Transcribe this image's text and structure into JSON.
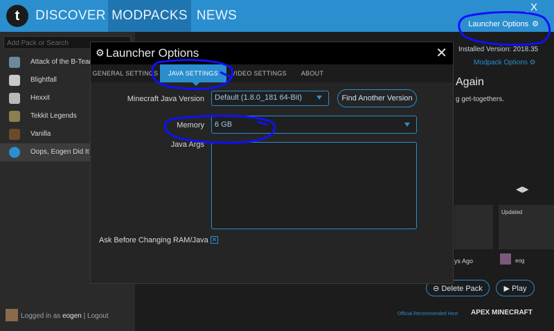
{
  "nav": {
    "tabs": [
      "DISCOVER",
      "MODPACKS",
      "NEWS"
    ],
    "active": "MODPACKS"
  },
  "window": {
    "minimize": "_",
    "close": "X"
  },
  "launcher_options_button": "Launcher Options",
  "sidebar": {
    "search_placeholder": "Add Pack or Search",
    "packs": [
      "Attack of the B-Team",
      "Blightfall",
      "Hexxit",
      "Tekkit Legends",
      "Vanilla",
      "Oops, Eogen Did It Ag"
    ]
  },
  "right": {
    "installed": "Installed Version: 2018.35",
    "modpack_options": "Modpack Options",
    "title_fragment": "Again",
    "desc_fragment": "g get-togethers.",
    "updated_fragment": "Updated",
    "ago_fragment": "ys Ago",
    "eog_fragment": "eog",
    "delete_btn": "Delete Pack",
    "play_btn": "Play"
  },
  "footer": {
    "logged_prefix": "Logged in as",
    "user": "eogen",
    "logout": "| Logout",
    "host_text": "Official Recommended Host",
    "apex": "APEX MINECRAFT"
  },
  "modal": {
    "title": "Launcher Options",
    "tabs": [
      "GENERAL SETTINGS",
      "JAVA SETTINGS",
      "VIDEO SETTINGS",
      "ABOUT"
    ],
    "active_tab": "JAVA SETTINGS",
    "java_version_label": "Minecraft Java Version",
    "java_version_value": "Default (1.8.0_181 64-Bit)",
    "find_button": "Find Another Version",
    "memory_label": "Memory",
    "memory_value": "6 GB",
    "java_args_label": "Java Args",
    "java_args_value": "",
    "ask_label": "Ask Before Changing RAM/Java",
    "ask_checked": true
  },
  "colors": {
    "accent": "#2b8ecf",
    "annotation": "#1010ff"
  }
}
